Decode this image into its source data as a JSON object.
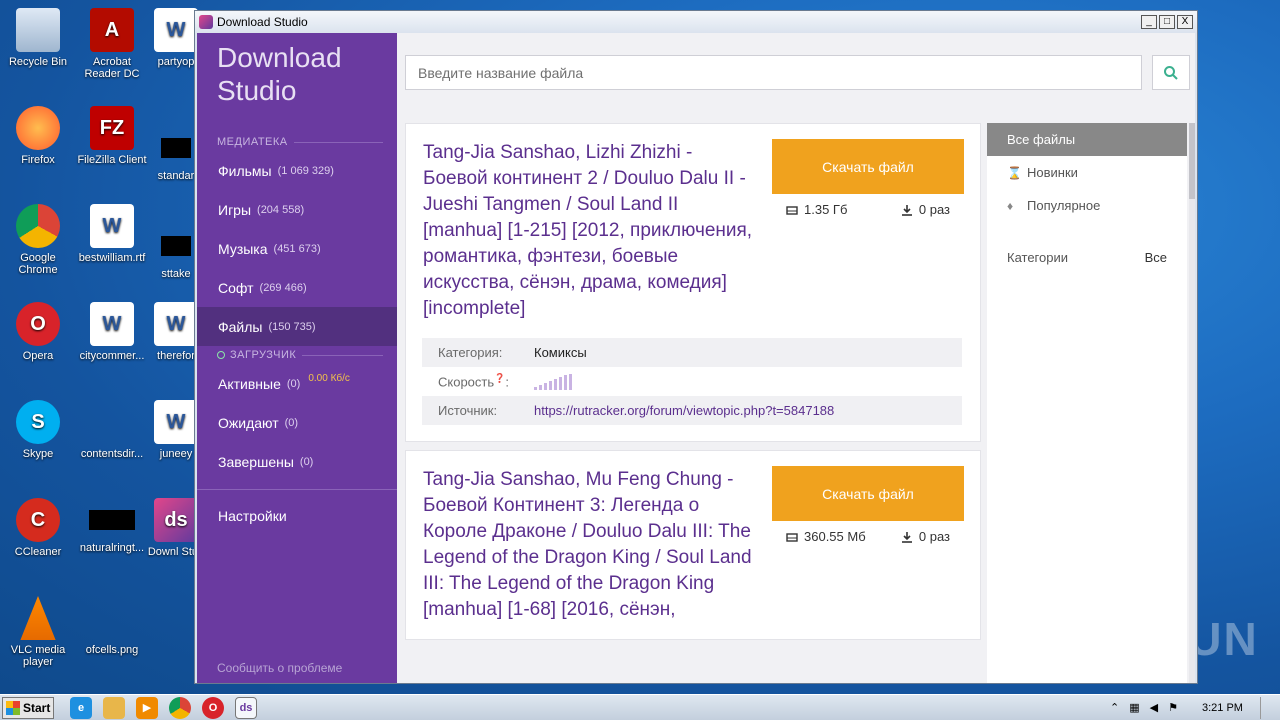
{
  "desktop": {
    "icons": [
      {
        "name": "recycle-bin",
        "label": "Recycle Bin"
      },
      {
        "name": "acrobat",
        "label": "Acrobat Reader DC"
      },
      {
        "name": "partyop",
        "label": "partyop"
      },
      {
        "name": "firefox",
        "label": "Firefox"
      },
      {
        "name": "filezilla",
        "label": "FileZilla Client"
      },
      {
        "name": "standar",
        "label": "standar"
      },
      {
        "name": "chrome",
        "label": "Google Chrome"
      },
      {
        "name": "bestwilliam",
        "label": "bestwilliam.rtf"
      },
      {
        "name": "sttake",
        "label": "sttake"
      },
      {
        "name": "opera",
        "label": "Opera"
      },
      {
        "name": "citycommer",
        "label": "citycommer..."
      },
      {
        "name": "therefor",
        "label": "therefor"
      },
      {
        "name": "skype",
        "label": "Skype"
      },
      {
        "name": "contentsdir",
        "label": "contentsdir..."
      },
      {
        "name": "juneey",
        "label": "juneey"
      },
      {
        "name": "ccleaner",
        "label": "CCleaner"
      },
      {
        "name": "naturalringt",
        "label": "naturalringt..."
      },
      {
        "name": "downl-stud",
        "label": "Downl Stud"
      },
      {
        "name": "vlc",
        "label": "VLC media player"
      },
      {
        "name": "ofcells",
        "label": "ofcells.png"
      }
    ]
  },
  "window": {
    "title": "Download Studio",
    "buttons": {
      "minimize": "_",
      "maximize": "□",
      "close": "X"
    }
  },
  "sidebar": {
    "brand": "Download Studio",
    "library_head": "МЕДИАТЕКА",
    "library": [
      {
        "label": "Фильмы",
        "count": "(1 069 329)"
      },
      {
        "label": "Игры",
        "count": "(204 558)"
      },
      {
        "label": "Музыка",
        "count": "(451 673)"
      },
      {
        "label": "Софт",
        "count": "(269 466)"
      },
      {
        "label": "Файлы",
        "count": "(150 735)"
      }
    ],
    "downloader_head": "ЗАГРУЗЧИК",
    "downloads": [
      {
        "label": "Активные",
        "count": "(0)",
        "speed": "0.00 Кб/с"
      },
      {
        "label": "Ожидают",
        "count": "(0)"
      },
      {
        "label": "Завершены",
        "count": "(0)"
      }
    ],
    "settings": "Настройки",
    "report": "Сообщить о проблеме"
  },
  "search": {
    "placeholder": "Введите название файла"
  },
  "results": [
    {
      "title": "Tang-Jia Sanshao, Lizhi Zhizhi - Боевой континент 2 / Douluo Dalu II - Jueshi Tangmen / Soul Land II [manhua] [1-215] [2012, приключения, романтика, фэнтези, боевые искусства, сёнэн, драма, комедия] [incomplete]",
      "button": "Скачать файл",
      "size": "1.35 Гб",
      "downloads": "0 раз",
      "category_label": "Категория:",
      "category": "Комиксы",
      "speed_label": "Скорость",
      "source_label": "Источник:",
      "source": "https://rutracker.org/forum/viewtopic.php?t=5847188"
    },
    {
      "title": "Tang-Jia Sanshao, Mu Feng Chung - Боевой Континент 3: Легенда о Короле Драконе / Douluo Dalu III: The Legend of the Dragon King / Soul Land III: The Legend of the Dragon King [manhua] [1-68] [2016, сёнэн,",
      "button": "Скачать файл",
      "size": "360.55 Мб",
      "downloads": "0 раз"
    }
  ],
  "filters": {
    "items": [
      "Все файлы",
      "Новинки",
      "Популярное"
    ],
    "category_label": "Категории",
    "category_value": "Все"
  },
  "watermark": "ANY RUN",
  "taskbar": {
    "start": "Start",
    "time": "3:21 PM"
  }
}
